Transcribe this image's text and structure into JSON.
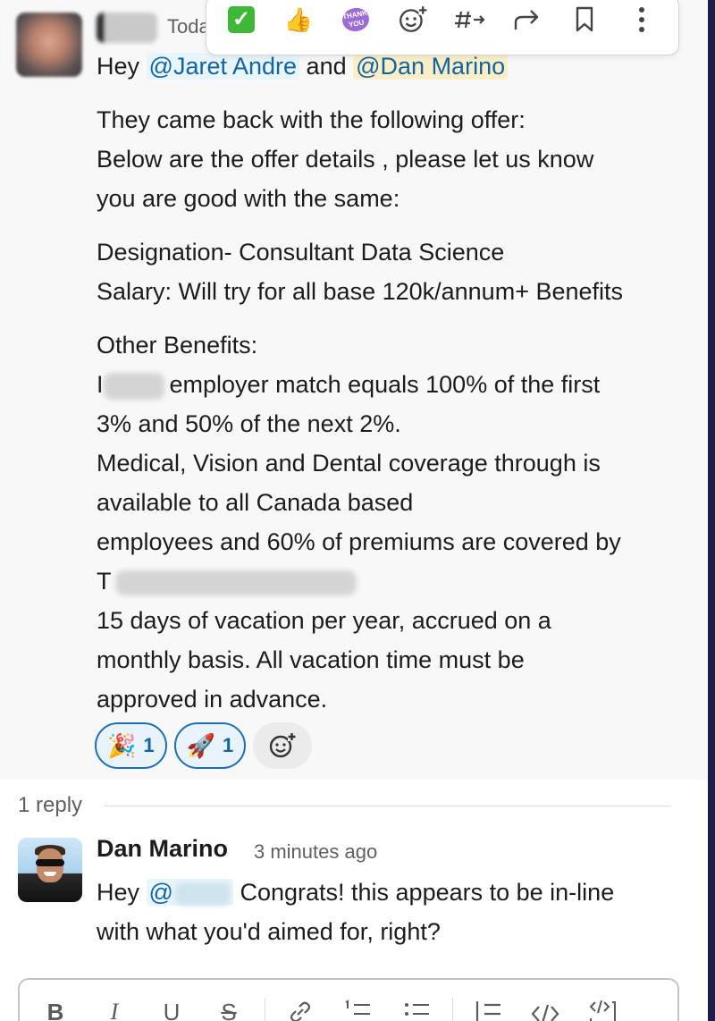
{
  "window": {
    "accent": "#1264a3",
    "edge_color": "#1a1d4a"
  },
  "parent_message": {
    "time_partial": "Toda",
    "greeting": {
      "prefix": "Hey",
      "mention1": "@Jaret Andre",
      "joiner": "and",
      "mention2": "@Dan Marino"
    },
    "lines": [
      "They came back with the following offer:",
      "Below are the offer details , please let us know",
      "you are good with the same:",
      "Designation- Consultant Data Science",
      "Salary: Will try for all base 120k/annum+ Benefits",
      "Other Benefits:",
      "employer match equals 100% of the first",
      "3% and 50% of the next 2%.",
      "Medical, Vision and Dental coverage through is",
      "available to all Canada based",
      "employees and 60% of premiums are covered by",
      "T",
      "15 days of vacation per year, accrued on a",
      "monthly basis. All vacation time must be",
      "approved in advance."
    ],
    "redacted_prefix": "I",
    "reactions": [
      {
        "icon": "party-popper-icon",
        "emoji": "🎉",
        "count": "1"
      },
      {
        "icon": "rocket-icon",
        "emoji": "🚀",
        "count": "1"
      }
    ]
  },
  "toolbar": {
    "buttons": [
      {
        "icon": "checkmark-icon"
      },
      {
        "icon": "thumbs-up-icon",
        "glyph": "👍"
      },
      {
        "icon": "thank-you-icon",
        "text": "THANK YOU"
      },
      {
        "icon": "add-reaction-icon"
      },
      {
        "icon": "reply-in-thread-icon"
      },
      {
        "icon": "forward-icon"
      },
      {
        "icon": "bookmark-icon"
      },
      {
        "icon": "more-icon"
      }
    ]
  },
  "thread": {
    "reply_count": "1 reply",
    "reply": {
      "author": "Dan Marino",
      "time": "3 minutes ago",
      "line1_prefix": "Hey",
      "mention": "@",
      "line1_rest": "Congrats! this appears to be in-line",
      "line2": "with what you'd aimed for, right?"
    }
  },
  "composer": {
    "formatting": [
      {
        "name": "bold-icon",
        "glyph": "B"
      },
      {
        "name": "italic-icon",
        "glyph": "I"
      },
      {
        "name": "underline-icon",
        "glyph": "U"
      },
      {
        "name": "strikethrough-icon",
        "glyph": "S"
      },
      {
        "name": "link-icon"
      },
      {
        "name": "ordered-list-icon"
      },
      {
        "name": "bulleted-list-icon"
      },
      {
        "name": "blockquote-icon"
      },
      {
        "name": "code-icon"
      },
      {
        "name": "code-block-icon"
      }
    ]
  }
}
